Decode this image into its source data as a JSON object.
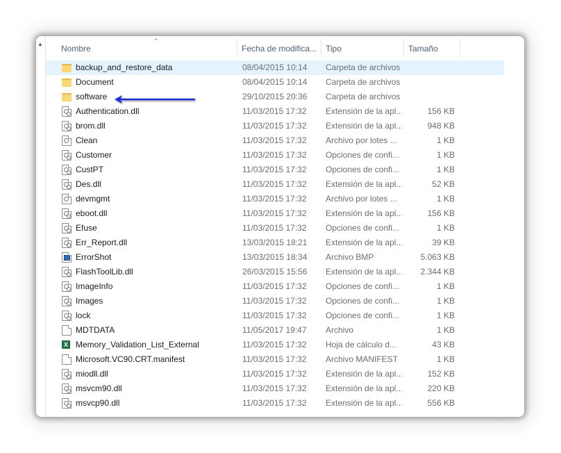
{
  "columns": {
    "name": "Nombre",
    "date": "Fecha de modifica...",
    "type": "Tipo",
    "size": "Tamaño"
  },
  "rows": [
    {
      "icon": "folder-icon",
      "name": "backup_and_restore_data",
      "date": "08/04/2015 10:14",
      "type": "Carpeta de archivos",
      "size": "",
      "selected": true
    },
    {
      "icon": "folder-icon",
      "name": "Document",
      "date": "08/04/2015 10:14",
      "type": "Carpeta de archivos",
      "size": ""
    },
    {
      "icon": "folder-icon",
      "name": "software",
      "date": "29/10/2015 20:36",
      "type": "Carpeta de archivos",
      "size": ""
    },
    {
      "icon": "dll-file-icon",
      "name": "Authentication.dll",
      "date": "11/03/2015 17:32",
      "type": "Extensión de la apl...",
      "size": "156 KB"
    },
    {
      "icon": "dll-file-icon",
      "name": "brom.dll",
      "date": "11/03/2015 17:32",
      "type": "Extensión de la apl...",
      "size": "948 KB"
    },
    {
      "icon": "batch-file-icon",
      "name": "Clean",
      "date": "11/03/2015 17:32",
      "type": "Archivo por lotes ...",
      "size": "1 KB"
    },
    {
      "icon": "config-file-icon",
      "name": "Customer",
      "date": "11/03/2015 17:32",
      "type": "Opciones de confi...",
      "size": "1 KB"
    },
    {
      "icon": "config-file-icon",
      "name": "CustPT",
      "date": "11/03/2015 17:32",
      "type": "Opciones de confi...",
      "size": "1 KB"
    },
    {
      "icon": "dll-file-icon",
      "name": "Des.dll",
      "date": "11/03/2015 17:32",
      "type": "Extensión de la apl...",
      "size": "52 KB"
    },
    {
      "icon": "batch-file-icon",
      "name": "devmgmt",
      "date": "11/03/2015 17:32",
      "type": "Archivo por lotes ...",
      "size": "1 KB"
    },
    {
      "icon": "dll-file-icon",
      "name": "eboot.dll",
      "date": "11/03/2015 17:32",
      "type": "Extensión de la apl...",
      "size": "156 KB"
    },
    {
      "icon": "config-file-icon",
      "name": "Efuse",
      "date": "11/03/2015 17:32",
      "type": "Opciones de confi...",
      "size": "1 KB"
    },
    {
      "icon": "dll-file-icon",
      "name": "Err_Report.dll",
      "date": "13/03/2015 18:21",
      "type": "Extensión de la apl...",
      "size": "39 KB"
    },
    {
      "icon": "bmp-file-icon",
      "name": "ErrorShot",
      "date": "13/03/2015 18:34",
      "type": "Archivo BMP",
      "size": "5.063 KB"
    },
    {
      "icon": "dll-file-icon",
      "name": "FlashToolLib.dll",
      "date": "26/03/2015 15:56",
      "type": "Extensión de la apl...",
      "size": "2.344 KB"
    },
    {
      "icon": "config-file-icon",
      "name": "ImageInfo",
      "date": "11/03/2015 17:32",
      "type": "Opciones de confi...",
      "size": "1 KB"
    },
    {
      "icon": "config-file-icon",
      "name": "Images",
      "date": "11/03/2015 17:32",
      "type": "Opciones de confi...",
      "size": "1 KB"
    },
    {
      "icon": "config-file-icon",
      "name": "lock",
      "date": "11/03/2015 17:32",
      "type": "Opciones de confi...",
      "size": "1 KB"
    },
    {
      "icon": "generic-file-icon",
      "name": "MDTDATA",
      "date": "11/05/2017 19:47",
      "type": "Archivo",
      "size": "1 KB"
    },
    {
      "icon": "excel-file-icon",
      "name": "Memory_Validation_List_External",
      "date": "11/03/2015 17:32",
      "type": "Hoja de cálculo d...",
      "size": "43 KB"
    },
    {
      "icon": "generic-file-icon",
      "name": "Microsoft.VC90.CRT.manifest",
      "date": "11/03/2015 17:32",
      "type": "Archivo MANIFEST",
      "size": "1 KB"
    },
    {
      "icon": "dll-file-icon",
      "name": "miodll.dll",
      "date": "11/03/2015 17:32",
      "type": "Extensión de la apl...",
      "size": "152 KB"
    },
    {
      "icon": "dll-file-icon",
      "name": "msvcm90.dll",
      "date": "11/03/2015 17:32",
      "type": "Extensión de la apl...",
      "size": "220 KB"
    },
    {
      "icon": "dll-file-icon",
      "name": "msvcp90.dll",
      "date": "11/03/2015 17:32",
      "type": "Extensión de la apl...",
      "size": "556 KB"
    }
  ],
  "colors": {
    "arrow": "#1a2fd6",
    "selection": "#e5f3ff",
    "folder": "#f8d775"
  }
}
